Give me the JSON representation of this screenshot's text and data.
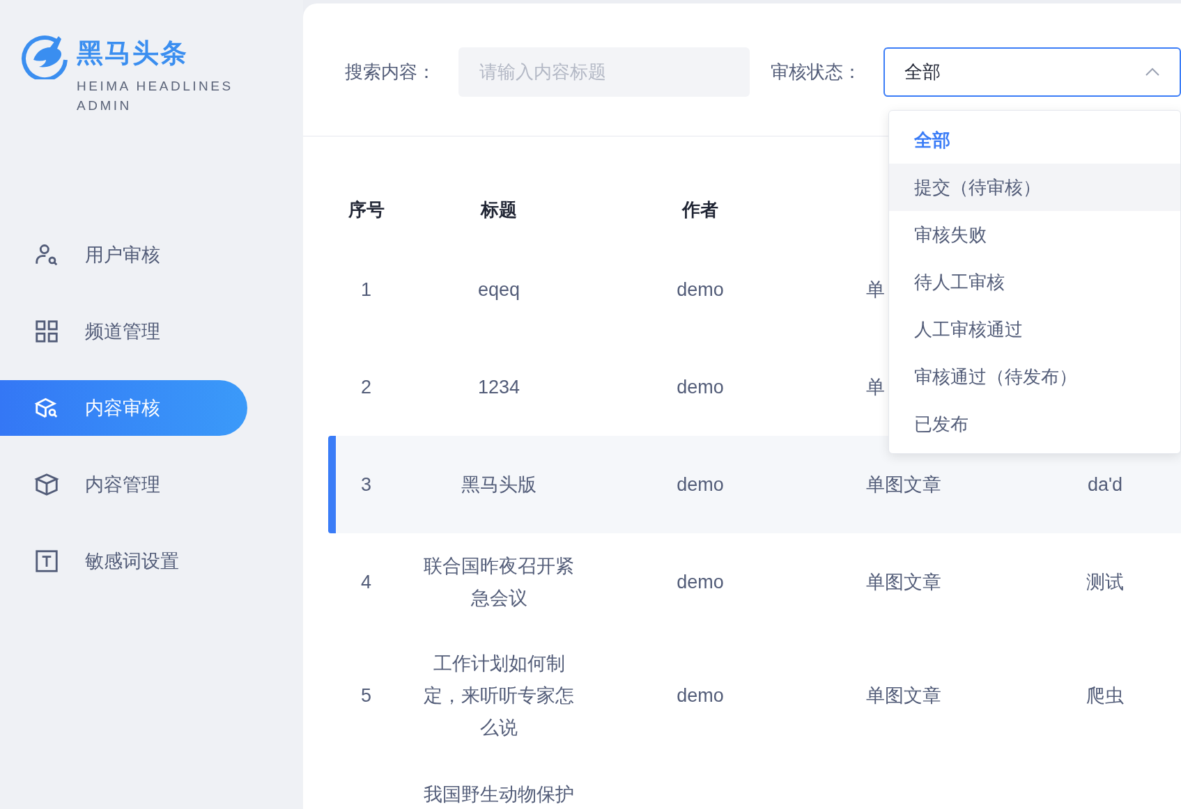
{
  "logo": {
    "title": "黑马头条",
    "subtitle": "HEIMA HEADLINES ADMIN"
  },
  "sidebar": {
    "items": [
      {
        "label": "用户审核",
        "selected": false
      },
      {
        "label": "频道管理",
        "selected": false
      },
      {
        "label": "内容审核",
        "selected": true
      },
      {
        "label": "内容管理",
        "selected": false
      },
      {
        "label": "敏感词设置",
        "selected": false
      }
    ]
  },
  "filters": {
    "search": {
      "label": "搜索内容：",
      "placeholder": "请输入内容标题"
    },
    "status": {
      "label": "审核状态：",
      "value": "全部",
      "expanded": true,
      "options": [
        {
          "label": "全部",
          "selected": true,
          "highlighted": false
        },
        {
          "label": "提交（待审核）",
          "selected": false,
          "highlighted": true
        },
        {
          "label": "审核失败",
          "selected": false,
          "highlighted": false
        },
        {
          "label": "待人工审核",
          "selected": false,
          "highlighted": false
        },
        {
          "label": "人工审核通过",
          "selected": false,
          "highlighted": false
        },
        {
          "label": "审核通过（待发布）",
          "selected": false,
          "highlighted": false
        },
        {
          "label": "已发布",
          "selected": false,
          "highlighted": false
        }
      ]
    }
  },
  "table": {
    "columns": [
      "序号",
      "标题",
      "作者"
    ],
    "rows": [
      {
        "cells": [
          "1",
          "eqeq",
          "demo",
          "单"
        ],
        "selected": false
      },
      {
        "cells": [
          "2",
          "1234",
          "demo",
          "单"
        ],
        "selected": false
      },
      {
        "cells": [
          "3",
          "黑马头版",
          "demo",
          "单图文章",
          "da'd"
        ],
        "selected": true
      },
      {
        "cells": [
          "4",
          "联合国昨夜召开紧急会议",
          "demo",
          "单图文章",
          "测试"
        ],
        "selected": false
      },
      {
        "cells": [
          "5",
          "工作计划如何制定，来听听专家怎么说",
          "demo",
          "单图文章",
          "爬虫"
        ],
        "selected": false
      },
      {
        "cells": [
          null,
          "我国野生动物保护"
        ],
        "selected": false
      }
    ]
  }
}
